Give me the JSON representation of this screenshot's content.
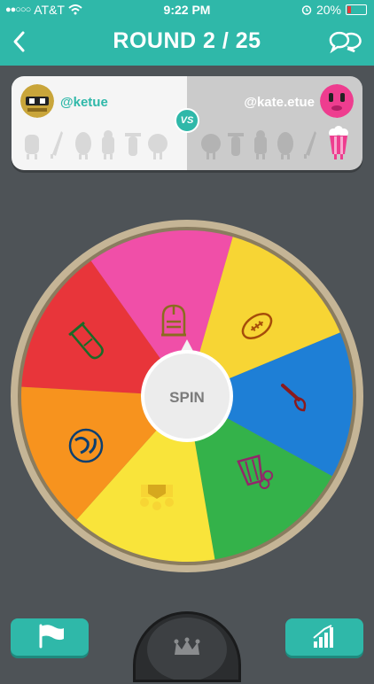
{
  "status_bar": {
    "carrier": "AT&T",
    "time": "9:22 PM",
    "battery": "20%"
  },
  "header": {
    "title": "ROUND 2 / 25"
  },
  "players": {
    "left": {
      "username": "@ketue",
      "avatar": "robot-avatar"
    },
    "versus": "VS",
    "right": {
      "username": "@kate.etue",
      "avatar": "pink-pig-avatar"
    }
  },
  "wheel": {
    "spin_label": "SPIN",
    "segments": [
      {
        "category": "art",
        "color": "#e8353a",
        "icon": "paintbrush-icon"
      },
      {
        "category": "entertainment",
        "color": "#f04fa8",
        "icon": "popcorn-icon"
      },
      {
        "category": "history",
        "color": "#f7d534",
        "icon": "crown-icon"
      },
      {
        "category": "geography",
        "color": "#1e7fd6",
        "icon": "globe-icon"
      },
      {
        "category": "science",
        "color": "#34b24a",
        "icon": "test-tube-icon"
      },
      {
        "category": "history",
        "color": "#f9e43a",
        "icon": "knight-helmet-icon"
      },
      {
        "category": "sports",
        "color": "#f7931e",
        "icon": "football-icon"
      }
    ]
  },
  "footer": {
    "left_icon": "flag-icon",
    "center_icon": "crown-icon",
    "right_icon": "bar-chart-icon"
  }
}
